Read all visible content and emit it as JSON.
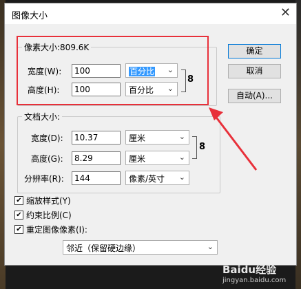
{
  "dialog": {
    "title": "图像大小"
  },
  "pixel_dims": {
    "legend": "像素大小:809.6K",
    "width_label": "宽度(W):",
    "width_value": "100",
    "width_unit": "百分比",
    "height_label": "高度(H):",
    "height_value": "100",
    "height_unit": "百分比"
  },
  "doc_size": {
    "legend": "文档大小:",
    "width_label": "宽度(D):",
    "width_value": "10.37",
    "width_unit": "厘米",
    "height_label": "高度(G):",
    "height_value": "8.29",
    "height_unit": "厘米",
    "res_label": "分辨率(R):",
    "res_value": "144",
    "res_unit": "像素/英寸"
  },
  "buttons": {
    "ok": "确定",
    "cancel": "取消",
    "auto": "自动(A)..."
  },
  "options": {
    "scale_styles": "缩放样式(Y)",
    "constrain": "约束比例(C)",
    "resample": "重定图像像素(I):",
    "resample_method": "邻近（保留硬边缘）"
  },
  "watermark": {
    "line1": "Baidu经验",
    "line2": "jingyan.baidu.com"
  },
  "colors": {
    "annotation": "#e8303a"
  }
}
